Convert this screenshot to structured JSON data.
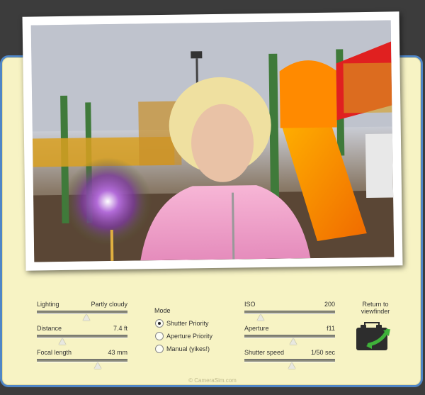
{
  "sliders": {
    "lighting": {
      "label": "Lighting",
      "value": "Partly cloudy",
      "level": 0.55
    },
    "distance": {
      "label": "Distance",
      "value": "7.4 ft",
      "level": 0.28
    },
    "focal_length": {
      "label": "Focal length",
      "value": "43 mm",
      "level": 0.67
    },
    "iso": {
      "label": "ISO",
      "value": "200",
      "level": 0.18
    },
    "aperture": {
      "label": "Aperture",
      "value": "f11",
      "level": 0.54
    },
    "shutter_speed": {
      "label": "Shutter speed",
      "value": "1/50 sec",
      "level": 0.52
    }
  },
  "mode": {
    "title": "Mode",
    "options": [
      "Shutter Priority",
      "Aperture Priority",
      "Manual (yikes!)"
    ],
    "selected": "Shutter Priority"
  },
  "return": {
    "label": "Return to viewfinder",
    "icon": "camera-icon"
  },
  "footer": "© CameraSim.com",
  "colors": {
    "panel": "#f7f3c4",
    "border": "#4f86c6",
    "background": "#3c3c3c"
  }
}
